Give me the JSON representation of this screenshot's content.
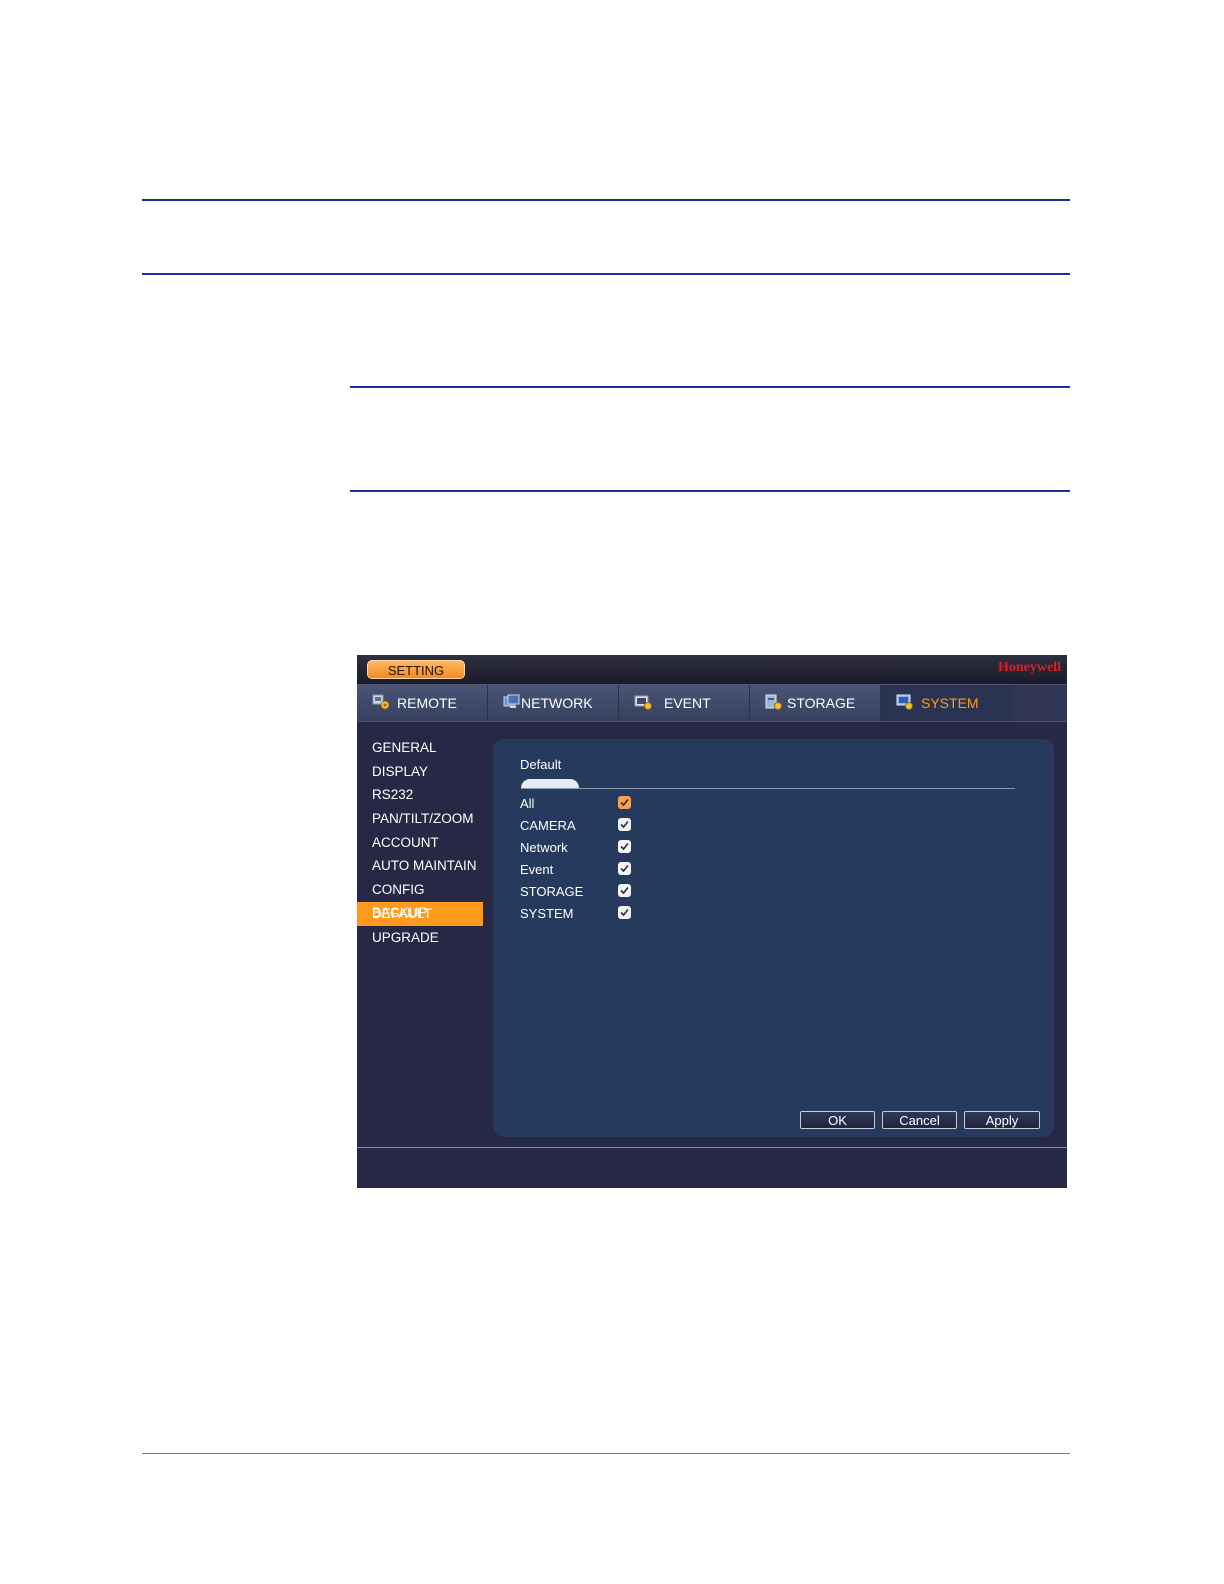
{
  "titlebar": {
    "setting_label": "SETTING",
    "brand": "Honeywell"
  },
  "tabs": [
    {
      "label": "REMOTE",
      "icon": "remote-settings-icon",
      "active": false
    },
    {
      "label": "NETWORK",
      "icon": "network-icon",
      "active": false
    },
    {
      "label": "EVENT",
      "icon": "event-icon",
      "active": false
    },
    {
      "label": "STORAGE",
      "icon": "storage-icon",
      "active": false
    },
    {
      "label": "SYSTEM",
      "icon": "system-icon",
      "active": true
    }
  ],
  "sidebar": {
    "items": [
      "GENERAL",
      "DISPLAY",
      "RS232",
      "PAN/TILT/ZOOM",
      "ACCOUNT",
      "AUTO MAINTAIN",
      "CONFIG BACKUP",
      "DEFAULT",
      "UPGRADE"
    ],
    "active": "DEFAULT"
  },
  "panel": {
    "title": "Default",
    "options": [
      {
        "label": "All",
        "checked": true
      },
      {
        "label": "CAMERA",
        "checked": true
      },
      {
        "label": "Network",
        "checked": true
      },
      {
        "label": "Event",
        "checked": true
      },
      {
        "label": "STORAGE",
        "checked": true
      },
      {
        "label": "SYSTEM",
        "checked": true
      }
    ],
    "buttons": {
      "ok": "OK",
      "cancel": "Cancel",
      "apply": "Apply"
    }
  },
  "colors": {
    "accent": "#ff9a1e",
    "brand": "#d91f26",
    "panel": "#253a5d",
    "background": "#272845"
  }
}
